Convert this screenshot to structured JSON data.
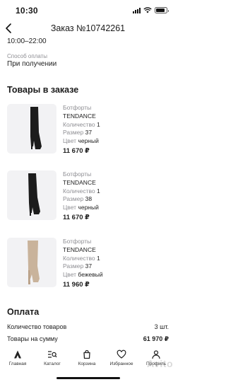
{
  "status_bar": {
    "time": "10:30",
    "battery_level": 0.85
  },
  "header": {
    "title": "Заказ №10742261"
  },
  "delivery": {
    "time_slot": "10:00–22:00"
  },
  "payment_method": {
    "label": "Способ оплаты",
    "value": "При получении"
  },
  "items_section": {
    "title": "Товары в заказе"
  },
  "items": [
    {
      "category": "Ботфорты",
      "brand": "TENDANCE",
      "qty_label": "Количество",
      "qty": "1",
      "size_label": "Размер",
      "size": "37",
      "color_label": "Цвет",
      "color": "черный",
      "price": "11 670 ₽",
      "boot_color": "#1c1c1c"
    },
    {
      "category": "Ботфорты",
      "brand": "TENDANCE",
      "qty_label": "Количество",
      "qty": "1",
      "size_label": "Размер",
      "size": "38",
      "color_label": "Цвет",
      "color": "черный",
      "price": "11 670 ₽",
      "boot_color": "#1c1c1c"
    },
    {
      "category": "Ботфорты",
      "brand": "TENDANCE",
      "qty_label": "Количество",
      "qty": "1",
      "size_label": "Размер",
      "size": "37",
      "color_label": "Цвет",
      "color": "бежевый",
      "price": "11 960 ₽",
      "boot_color": "#c9b39b"
    }
  ],
  "payment": {
    "title": "Оплата",
    "count_label": "Количество товаров",
    "count_value": "3 шт.",
    "sum_label": "Товары на сумму",
    "sum_value": "61 970 ₽"
  },
  "tabs": [
    {
      "label": "Главная",
      "icon": "home-icon"
    },
    {
      "label": "Каталог",
      "icon": "catalog-search-icon"
    },
    {
      "label": "Корзина",
      "icon": "cart-icon"
    },
    {
      "label": "Избранное",
      "icon": "heart-icon"
    },
    {
      "label": "Профиль",
      "icon": "profile-icon"
    }
  ],
  "watermark": "Avito"
}
